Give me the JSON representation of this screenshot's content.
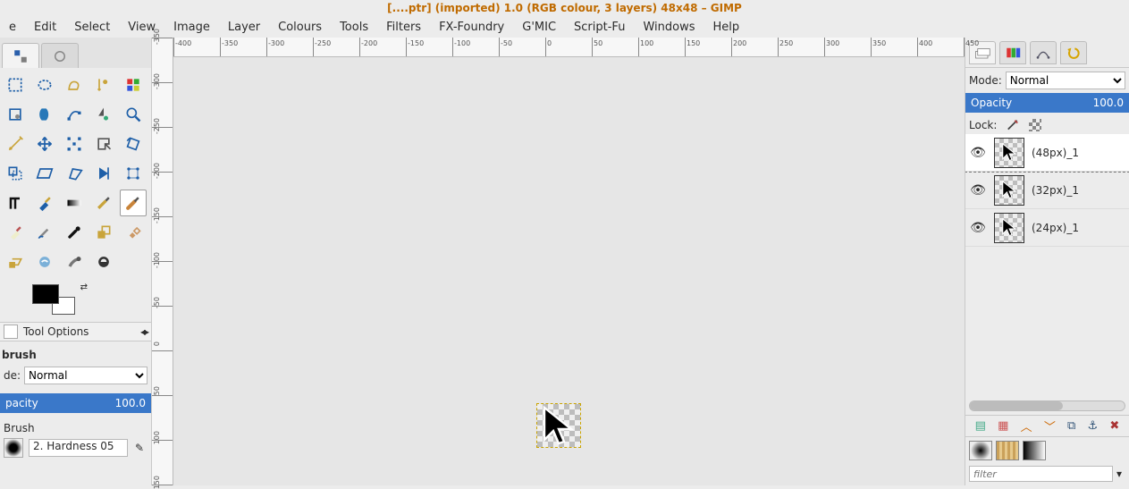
{
  "title_bar": "[....ptr] (imported)  1.0 (RGB colour, 3 layers) 48x48 – GIMP",
  "menu": [
    "e",
    "Edit",
    "Select",
    "View",
    "Image",
    "Layer",
    "Colours",
    "Tools",
    "Filters",
    "FX-Foundry",
    "G'MIC",
    "Script-Fu",
    "Windows",
    "Help"
  ],
  "h_ruler": [
    -400,
    -350,
    -300,
    -250,
    -200,
    -150,
    -100,
    -50,
    0,
    50,
    100,
    150,
    200,
    250,
    300,
    350,
    400,
    450
  ],
  "v_ruler": [
    -350,
    -300,
    -250,
    -200,
    -150,
    -100,
    -50,
    0,
    50,
    100,
    150
  ],
  "tool_options": {
    "tab_label": "Tool Options",
    "heading": "brush",
    "mode_label": "de:",
    "mode_value": "Normal",
    "opacity_label": "pacity",
    "opacity_value": "100.0",
    "brush_label": "Brush",
    "brush_name": "2. Hardness 05"
  },
  "layers_panel": {
    "mode_label": "Mode:",
    "mode_value": "Normal",
    "opacity_label": "Opacity",
    "opacity_value": "100.0",
    "lock_label": "Lock:",
    "layers": [
      {
        "name": "(48px)_1",
        "visible": true,
        "selected": true
      },
      {
        "name": "(32px)_1",
        "visible": true,
        "selected": false
      },
      {
        "name": "(24px)_1",
        "visible": true,
        "selected": false
      }
    ],
    "filter_placeholder": "filter"
  },
  "tool_names": [
    "rect-select",
    "ellipse-select",
    "free-select",
    "fuzzy-select",
    "by-color-select",
    "scissors-select",
    "foreground-select",
    "paths",
    "color-picker",
    "zoom",
    "measure",
    "move",
    "align",
    "crop",
    "rotate",
    "scale",
    "shear",
    "perspective",
    "flip",
    "cage",
    "text",
    "bucket-fill",
    "blend",
    "pencil",
    "paintbrush",
    "eraser",
    "airbrush",
    "ink",
    "clone",
    "heal",
    "perspective-clone",
    "blur-sharpen",
    "smudge",
    "dodge-burn",
    ""
  ]
}
